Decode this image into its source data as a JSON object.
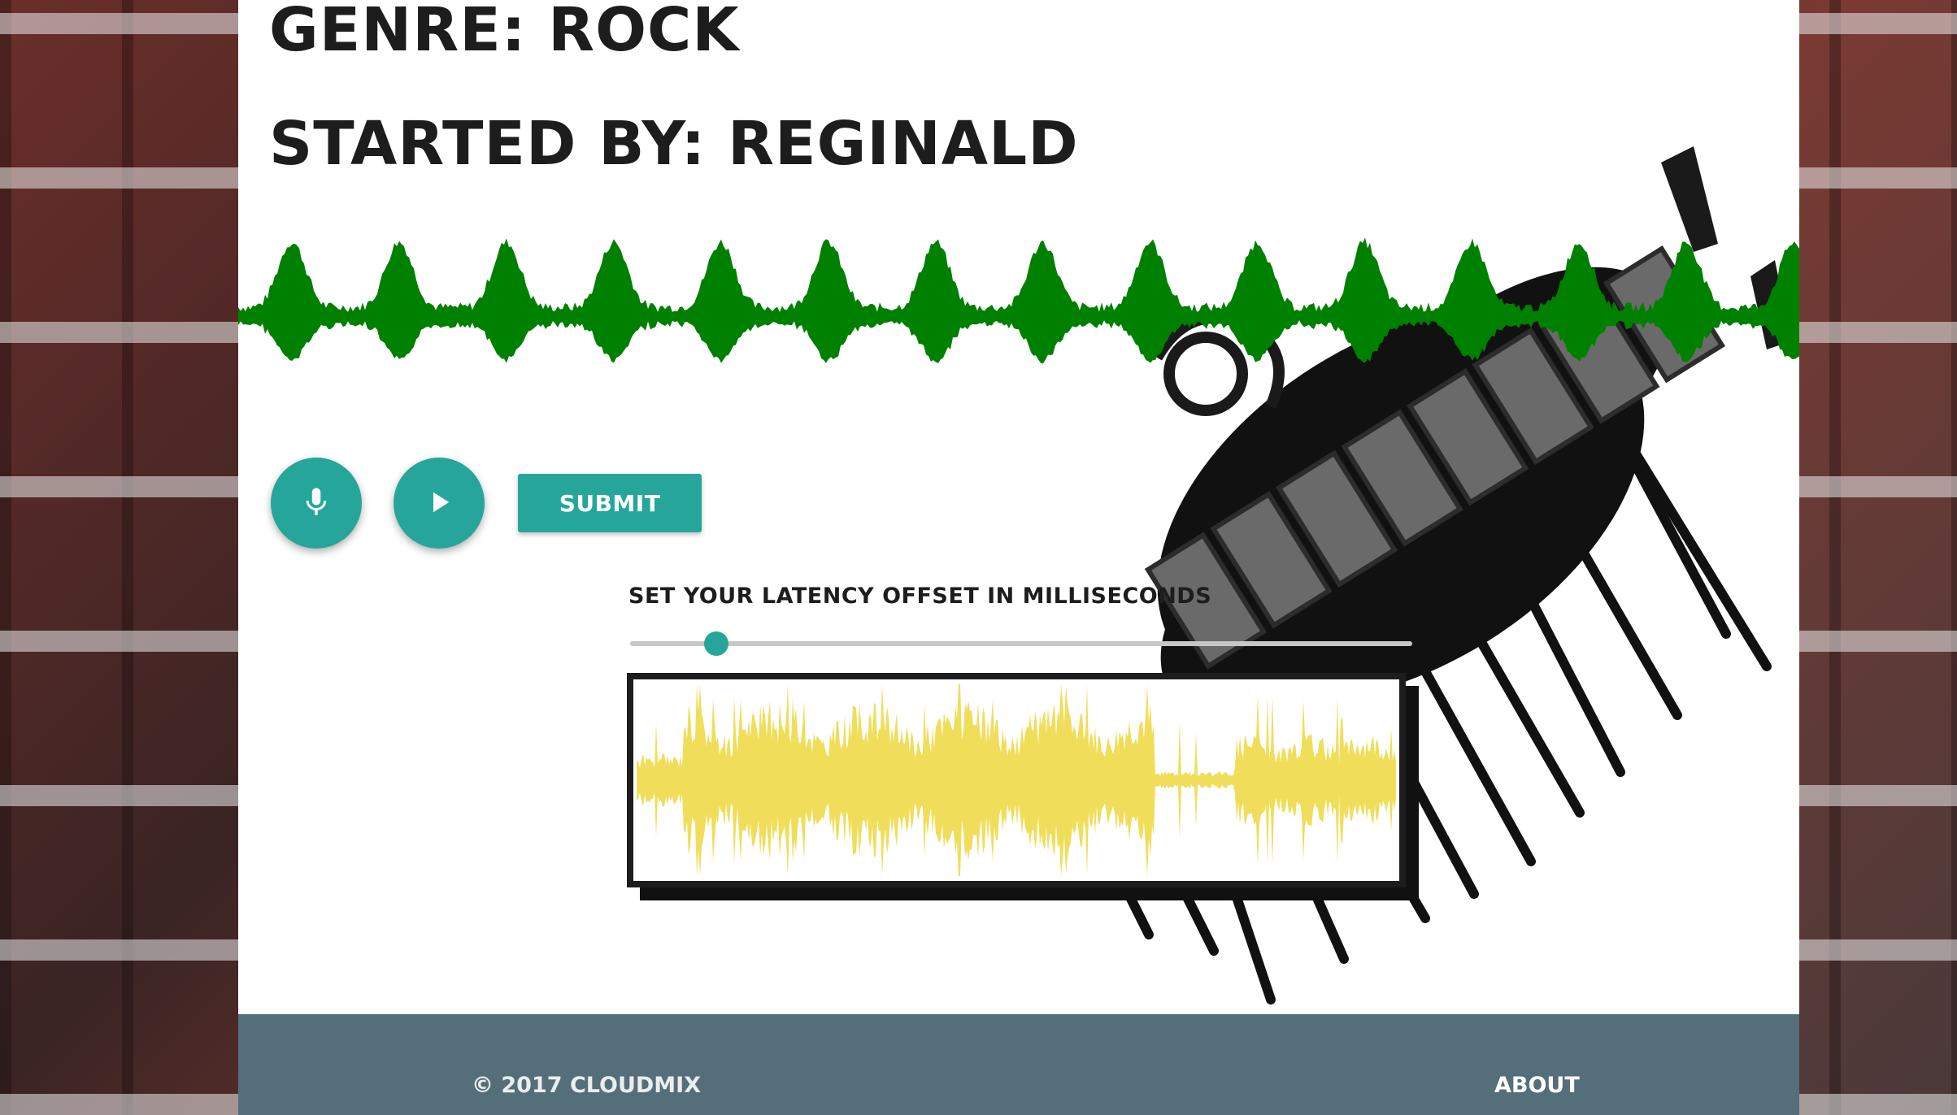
{
  "header": {
    "genre": "Genre: Rock",
    "started_by": "Started By: Reginald"
  },
  "controls": {
    "record_icon": "microphone-icon",
    "play_icon": "play-icon",
    "submit_label": "Submit"
  },
  "latency": {
    "label": "Set your latency offset in milliseconds",
    "slider_fraction": 0.11
  },
  "colors": {
    "accent": "#26a69a",
    "main_waveform": "#008000",
    "latency_waveform": "#f0de5a",
    "footer": "#546e7a"
  },
  "logo": {
    "name": "cloudmix-logo",
    "text": "CLOUDMIX"
  },
  "footer": {
    "copyright": "© 2017 CloudMix",
    "about": "About"
  }
}
